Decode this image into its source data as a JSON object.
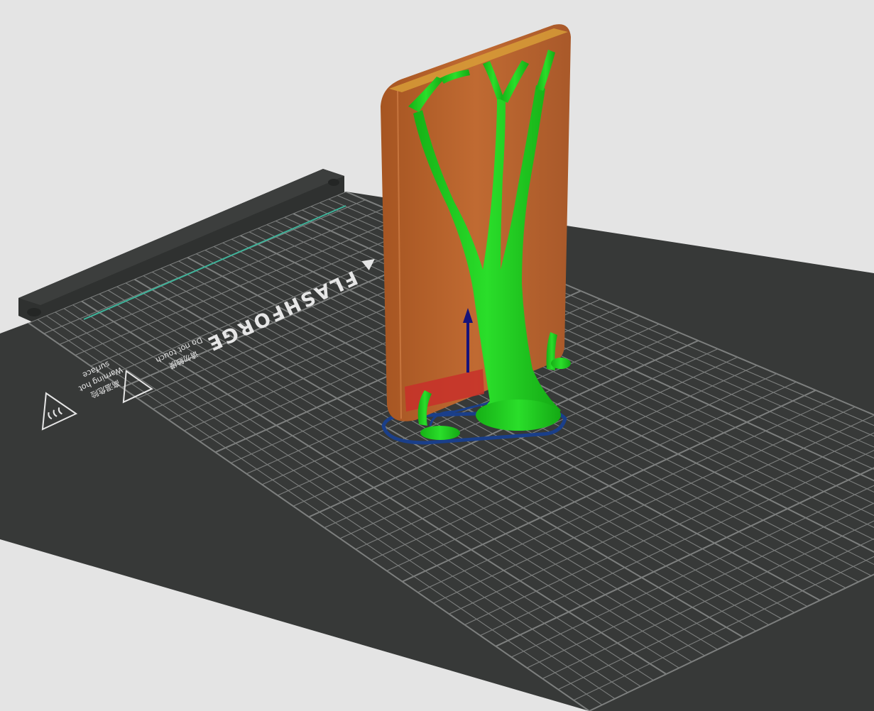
{
  "viewport": {
    "background": "#e4e4e4",
    "plate_color": "#373938",
    "grid_color": "#8a8c8b",
    "bed_frame_color": "#2f3130"
  },
  "bed": {
    "brand": "FLASHFORGE",
    "warning_hot_lines": [
      "高温危险",
      "Warning hot",
      "surface"
    ],
    "warning_touch_lines": [
      "请勿触摸",
      "Do not touch"
    ]
  },
  "model": {
    "part_color": "#b8642c",
    "support_color": "#1ec81e",
    "brim_color": "#1a3f8a",
    "axis_arrow_color": "#17137a"
  }
}
